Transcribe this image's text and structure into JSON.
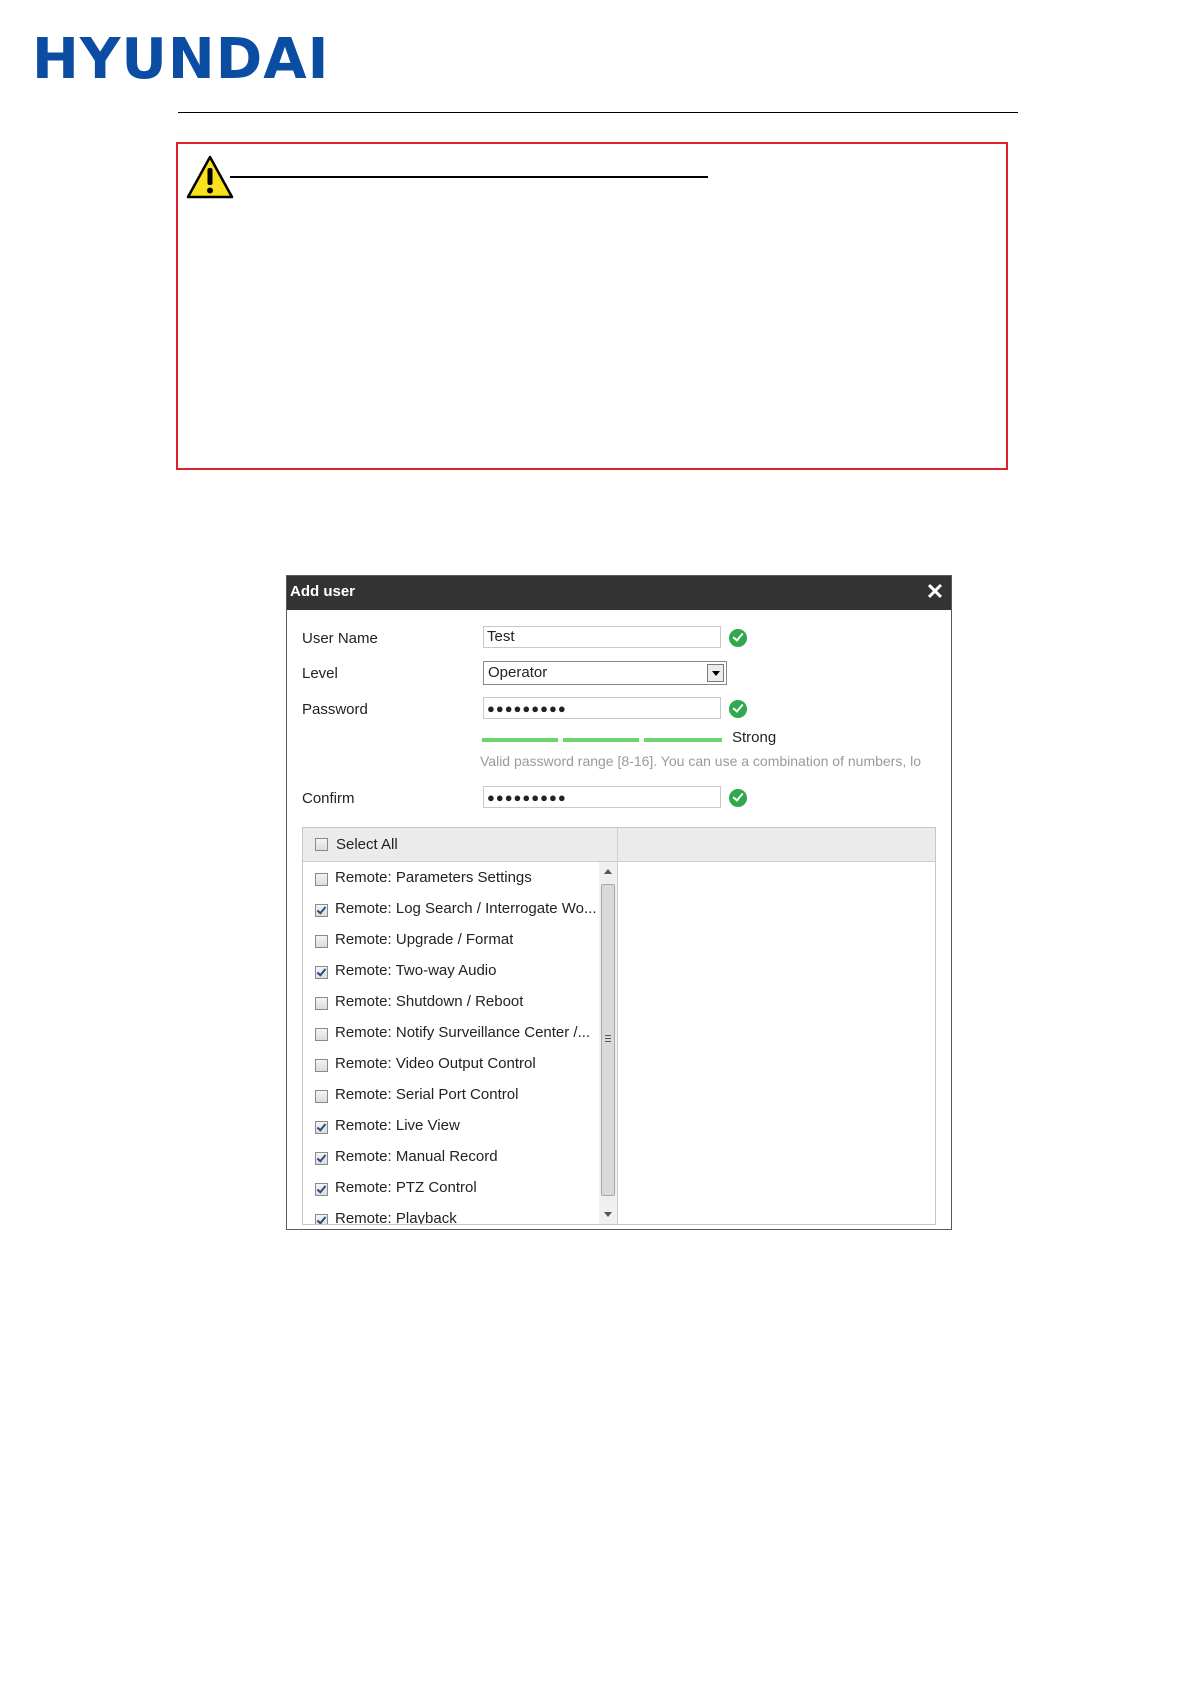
{
  "document": {
    "logo_text": "HYUNDAI"
  },
  "dialog": {
    "title": "Add user",
    "close_icon": "close-icon",
    "fields": {
      "user_name_label": "User Name",
      "user_name_value": "Test",
      "level_label": "Level",
      "level_value": "Operator",
      "password_label": "Password",
      "password_value": "●●●●●●●●●",
      "strength_label": "Strong",
      "password_hint": "Valid password range [8-16]. You can use a combination of numbers, lo",
      "confirm_label": "Confirm",
      "confirm_value": "●●●●●●●●●"
    },
    "colors": {
      "titlebar": "#333333",
      "strength": "#6fd36f",
      "valid": "#2fa84f",
      "warning_border": "#d9242b"
    },
    "permissions": {
      "select_all_label": "Select All",
      "select_all_checked": false,
      "items": [
        {
          "label": "Remote: Parameters Settings",
          "checked": false
        },
        {
          "label": "Remote: Log Search / Interrogate Wo...",
          "checked": true
        },
        {
          "label": "Remote: Upgrade / Format",
          "checked": false
        },
        {
          "label": "Remote: Two-way Audio",
          "checked": true
        },
        {
          "label": "Remote: Shutdown / Reboot",
          "checked": false
        },
        {
          "label": "Remote: Notify Surveillance Center /...",
          "checked": false
        },
        {
          "label": "Remote: Video Output Control",
          "checked": false
        },
        {
          "label": "Remote: Serial Port Control",
          "checked": false
        },
        {
          "label": "Remote: Live View",
          "checked": true
        },
        {
          "label": "Remote: Manual Record",
          "checked": true
        },
        {
          "label": "Remote: PTZ Control",
          "checked": true
        },
        {
          "label": "Remote: Playback",
          "checked": true
        }
      ]
    }
  }
}
